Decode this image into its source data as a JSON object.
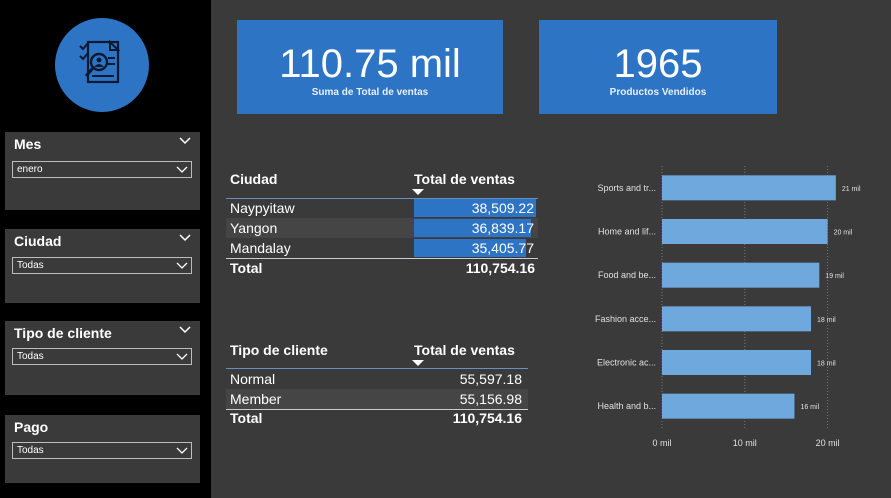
{
  "sidebar": {
    "logo_icon": "search-document-icon",
    "slicers": [
      {
        "title": "Mes",
        "value": "enero"
      },
      {
        "title": "Ciudad",
        "value": "Todas"
      },
      {
        "title": "Tipo de cliente",
        "value": "Todas"
      },
      {
        "title": "Pago",
        "value": "Todas"
      }
    ]
  },
  "kpis": [
    {
      "value": "110.75 mil",
      "label": "Suma de Total de ventas"
    },
    {
      "value": "1965",
      "label": "Productos Vendidos"
    }
  ],
  "city_table": {
    "headers": [
      "Ciudad",
      "Total de ventas"
    ],
    "rows": [
      {
        "name": "Naypyitaw",
        "value": "38,509.22",
        "bar_fraction": 1.0
      },
      {
        "name": "Yangon",
        "value": "36,839.17",
        "bar_fraction": 0.957
      },
      {
        "name": "Mandalay",
        "value": "35,405.77",
        "bar_fraction": 0.919
      }
    ],
    "total_label": "Total",
    "total_value": "110,754.16"
  },
  "customer_table": {
    "headers": [
      "Tipo de cliente",
      "Total de ventas"
    ],
    "rows": [
      {
        "name": "Normal",
        "value": "55,597.18"
      },
      {
        "name": "Member",
        "value": "55,156.98"
      }
    ],
    "total_label": "Total",
    "total_value": "110,754.16"
  },
  "colors": {
    "accent": "#2e74c4",
    "bar": "#6fa8dc",
    "background": "#3a3a3a",
    "sidebar": "#000000"
  },
  "chart_data": {
    "type": "bar",
    "orientation": "horizontal",
    "categories": [
      "Sports and tr...",
      "Home and lif...",
      "Food and be...",
      "Fashion acce...",
      "Electronic ac...",
      "Health and b..."
    ],
    "values": [
      21,
      20,
      19,
      18,
      18,
      16
    ],
    "data_labels": [
      "21 mil",
      "20 mil",
      "19 mil",
      "18 mil",
      "18 mil",
      "16 mil"
    ],
    "xticks": [
      0,
      10,
      20
    ],
    "xtick_labels": [
      "0 mil",
      "10 mil",
      "20 mil"
    ],
    "xlim": [
      0,
      21.5
    ],
    "grid": true
  }
}
